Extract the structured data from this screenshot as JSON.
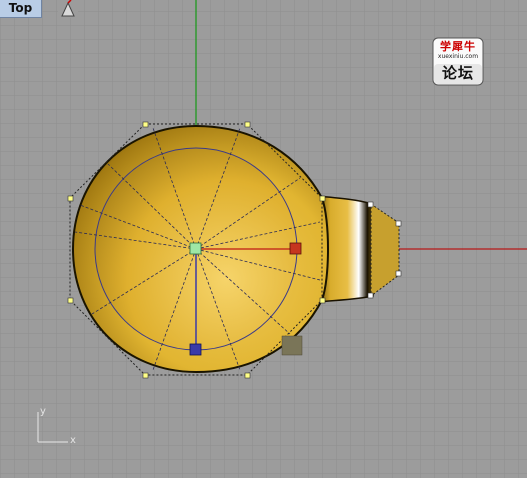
{
  "viewport": {
    "name": "Top"
  },
  "watermark": {
    "line1": "学犀牛",
    "line2": "xuexiniu.com",
    "line3": "论坛"
  },
  "axis_icon": {
    "y": "y",
    "x": "x"
  },
  "icons": {
    "viewport_menu": "sundial-icon"
  },
  "colors": {
    "background": "#9c9c9c",
    "grid": "#8e8e8e",
    "x_axis": "#b71818",
    "y_axis": "#169a16",
    "model": "#e1b531",
    "control_point": "#ffff88",
    "gumball_x": "#c6351f",
    "gumball_y": "#3a3aa8",
    "gumball_center": "#9ee7a6"
  }
}
